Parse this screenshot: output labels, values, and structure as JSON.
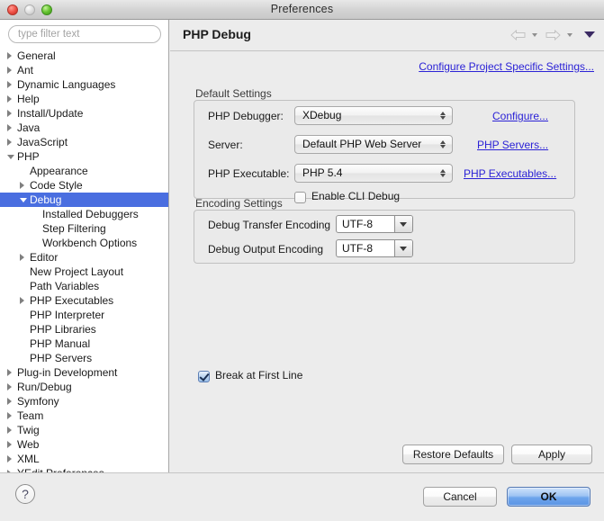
{
  "window": {
    "title": "Preferences",
    "traffic": {
      "close": "close-button",
      "minimize": "minimize-button",
      "zoom": "zoom-button"
    }
  },
  "sidebar": {
    "filter": {
      "placeholder": "type filter text",
      "value": ""
    },
    "items": [
      {
        "label": "General",
        "indent": 0,
        "state": "collapsed",
        "selected": false
      },
      {
        "label": "Ant",
        "indent": 0,
        "state": "collapsed",
        "selected": false
      },
      {
        "label": "Dynamic Languages",
        "indent": 0,
        "state": "collapsed",
        "selected": false
      },
      {
        "label": "Help",
        "indent": 0,
        "state": "collapsed",
        "selected": false
      },
      {
        "label": "Install/Update",
        "indent": 0,
        "state": "collapsed",
        "selected": false
      },
      {
        "label": "Java",
        "indent": 0,
        "state": "collapsed",
        "selected": false
      },
      {
        "label": "JavaScript",
        "indent": 0,
        "state": "collapsed",
        "selected": false
      },
      {
        "label": "PHP",
        "indent": 0,
        "state": "expanded",
        "selected": false
      },
      {
        "label": "Appearance",
        "indent": 1,
        "state": "leaf",
        "selected": false
      },
      {
        "label": "Code Style",
        "indent": 1,
        "state": "collapsed",
        "selected": false
      },
      {
        "label": "Debug",
        "indent": 1,
        "state": "expanded",
        "selected": true
      },
      {
        "label": "Installed Debuggers",
        "indent": 2,
        "state": "leaf",
        "selected": false
      },
      {
        "label": "Step Filtering",
        "indent": 2,
        "state": "leaf",
        "selected": false
      },
      {
        "label": "Workbench Options",
        "indent": 2,
        "state": "leaf",
        "selected": false
      },
      {
        "label": "Editor",
        "indent": 1,
        "state": "collapsed",
        "selected": false
      },
      {
        "label": "New Project Layout",
        "indent": 1,
        "state": "leaf",
        "selected": false
      },
      {
        "label": "Path Variables",
        "indent": 1,
        "state": "leaf",
        "selected": false
      },
      {
        "label": "PHP Executables",
        "indent": 1,
        "state": "collapsed",
        "selected": false
      },
      {
        "label": "PHP Interpreter",
        "indent": 1,
        "state": "leaf",
        "selected": false
      },
      {
        "label": "PHP Libraries",
        "indent": 1,
        "state": "leaf",
        "selected": false
      },
      {
        "label": "PHP Manual",
        "indent": 1,
        "state": "leaf",
        "selected": false
      },
      {
        "label": "PHP Servers",
        "indent": 1,
        "state": "leaf",
        "selected": false
      },
      {
        "label": "Plug-in Development",
        "indent": 0,
        "state": "collapsed",
        "selected": false
      },
      {
        "label": "Run/Debug",
        "indent": 0,
        "state": "collapsed",
        "selected": false
      },
      {
        "label": "Symfony",
        "indent": 0,
        "state": "collapsed",
        "selected": false
      },
      {
        "label": "Team",
        "indent": 0,
        "state": "collapsed",
        "selected": false
      },
      {
        "label": "Twig",
        "indent": 0,
        "state": "collapsed",
        "selected": false
      },
      {
        "label": "Web",
        "indent": 0,
        "state": "collapsed",
        "selected": false
      },
      {
        "label": "XML",
        "indent": 0,
        "state": "collapsed",
        "selected": false
      },
      {
        "label": "YEdit Preferences",
        "indent": 0,
        "state": "collapsed",
        "selected": false
      }
    ]
  },
  "content": {
    "page_title": "PHP Debug",
    "nav": {
      "back_icon": "back-arrow-icon",
      "forward_icon": "forward-arrow-icon",
      "menu_icon": "view-menu-icon"
    },
    "project_specific_link": "Configure Project Specific Settings...",
    "default_settings": {
      "group_title": "Default Settings",
      "debugger_label": "PHP Debugger:",
      "debugger_value": "XDebug",
      "server_label": "Server:",
      "server_value": "Default PHP Web Server",
      "executable_label": "PHP Executable:",
      "executable_value": "PHP 5.4",
      "configure_link": "Configure...",
      "servers_link": "PHP Servers...",
      "executables_link": "PHP Executables...",
      "cli_checkbox_label": "Enable CLI Debug",
      "cli_checkbox_checked": false
    },
    "encoding_settings": {
      "group_title": "Encoding Settings",
      "transfer_label": "Debug Transfer Encoding",
      "transfer_value": "UTF-8",
      "output_label": "Debug Output Encoding",
      "output_value": "UTF-8"
    },
    "break_checkbox_label": "Break at First Line",
    "break_checkbox_checked": true,
    "restore_defaults_button": "Restore Defaults",
    "apply_button": "Apply"
  },
  "footer": {
    "help_glyph": "?",
    "cancel_button": "Cancel",
    "ok_button": "OK"
  },
  "colors": {
    "selection_blue": "#4a6ee0",
    "link_blue": "#2b22d6",
    "default_button_blue": "#5b94e4",
    "window_bg": "#ececec"
  }
}
